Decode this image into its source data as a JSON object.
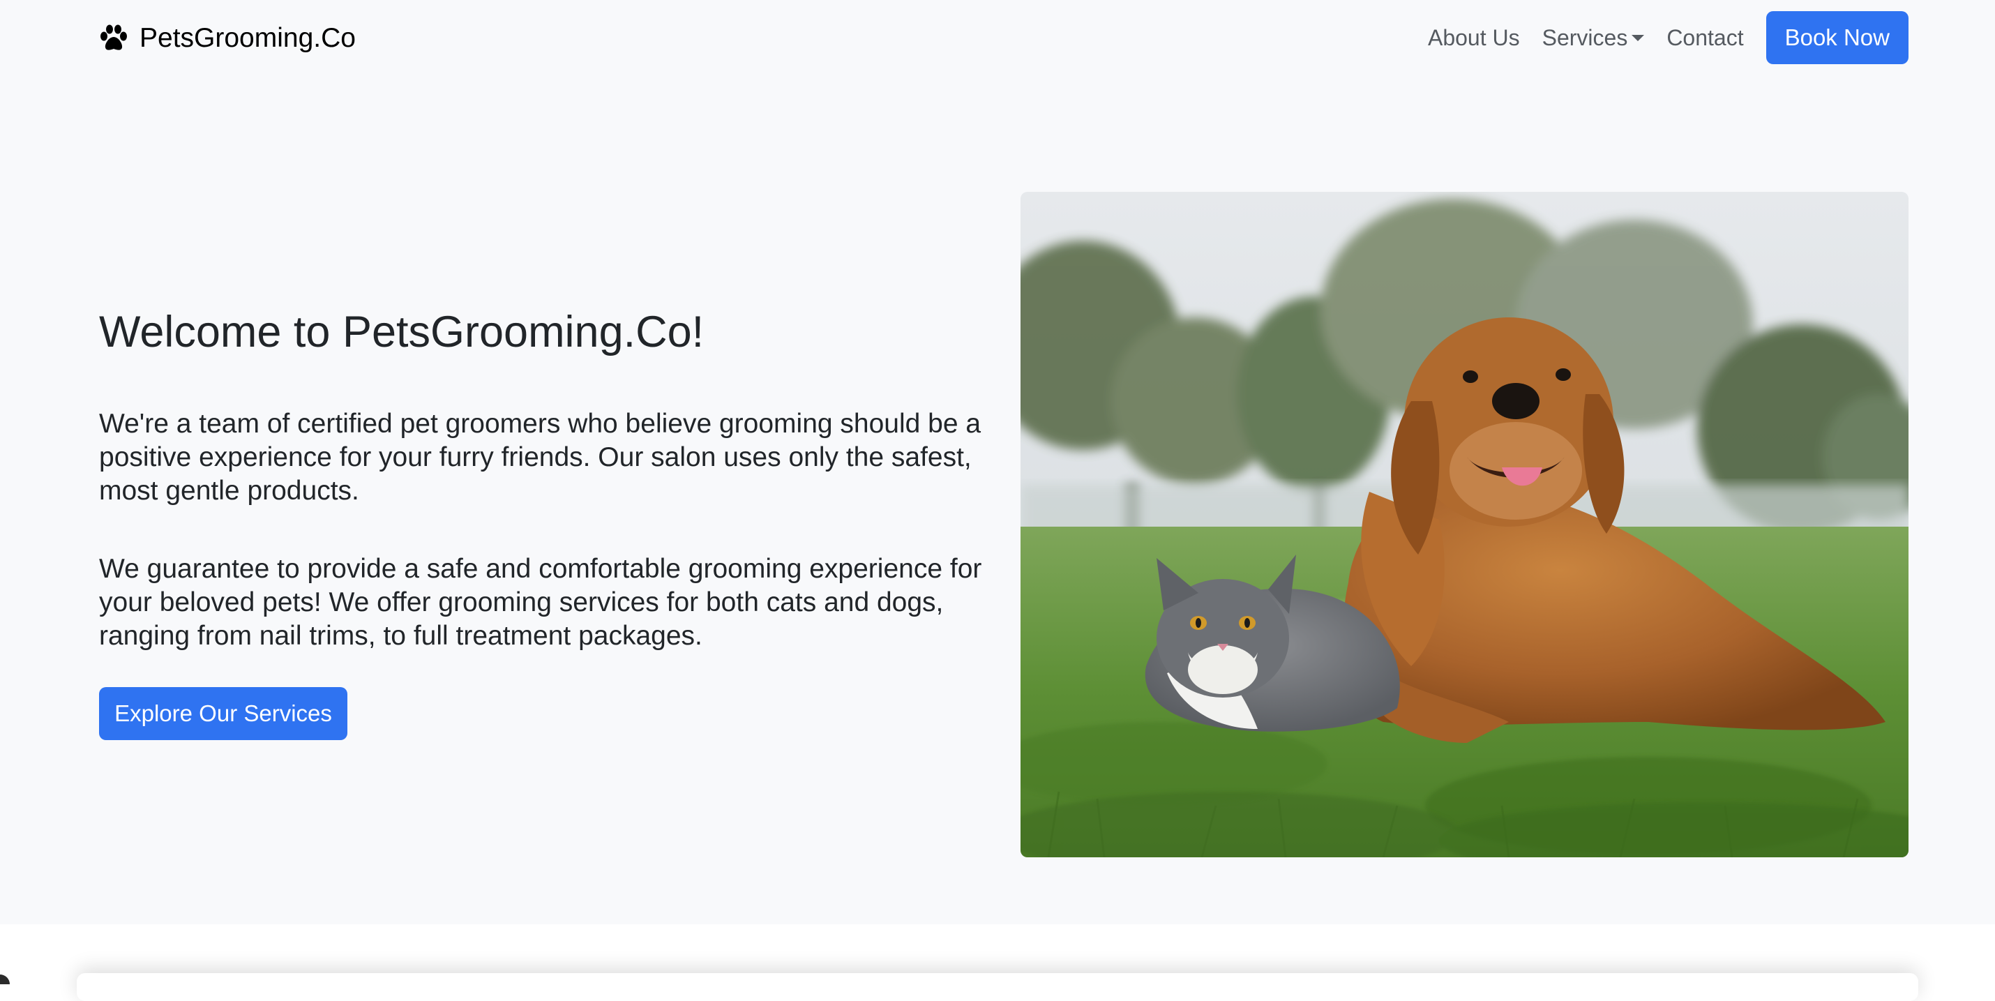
{
  "navbar": {
    "brand": "PetsGrooming.Co",
    "links": [
      "About Us",
      "Services",
      "Contact"
    ],
    "book_button": "Book Now"
  },
  "hero": {
    "title": "Welcome to PetsGrooming.Co!",
    "paragraphs": [
      "We're a team of certified pet groomers who believe grooming should be a positive experience for your furry friends. Our salon uses only the safest, most gentle products.",
      "We guarantee to provide a safe and comfortable grooming experience for your beloved pets! We offer grooming services for both cats and dogs, ranging from nail trims, to full treatment packages."
    ],
    "cta_button": "Explore Our Services",
    "image": {
      "content": "golden-retriever-and-gray-cat-on-grass"
    }
  },
  "icons": {
    "brand_icon": "paw-icon",
    "services_dropdown_icon": "caret-down-icon"
  },
  "colors": {
    "primary": "#2f73f1",
    "hero_background": "#f8f9fb",
    "text": "#212529",
    "nav_link": "#555a60"
  }
}
